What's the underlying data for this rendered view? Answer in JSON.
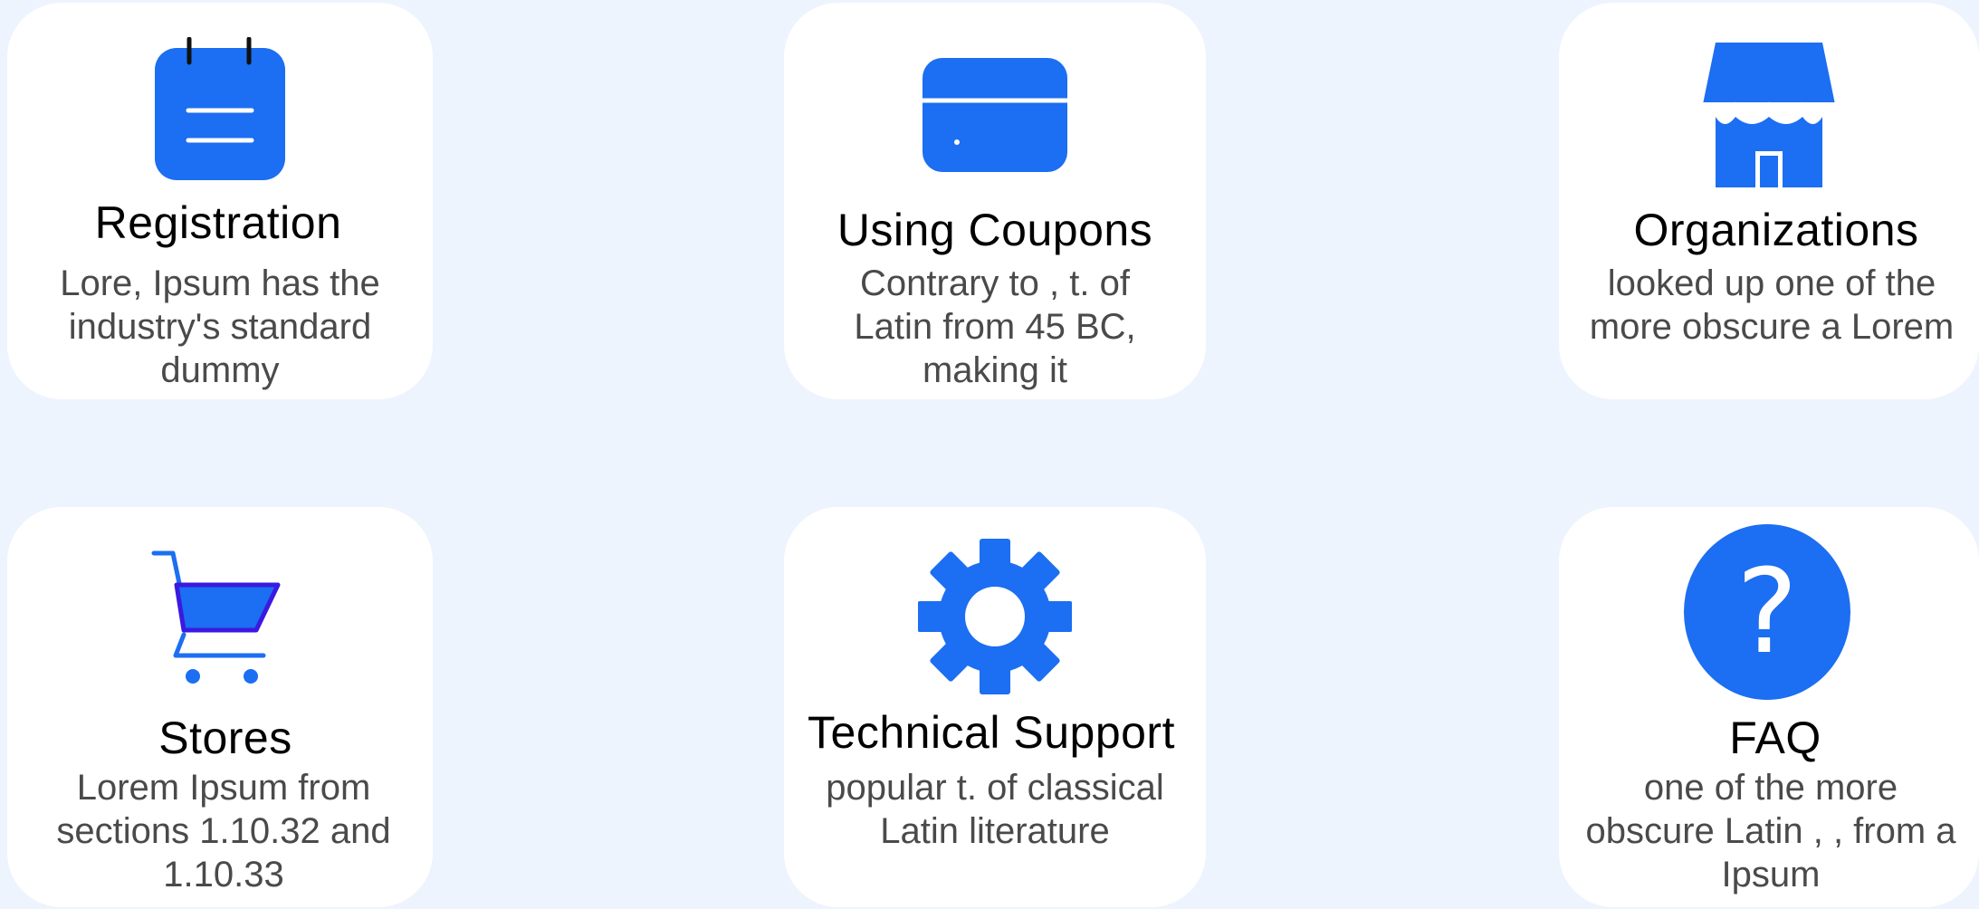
{
  "colors": {
    "background": "#eef4fe",
    "card": "#ffffff",
    "accent": "#1c6ef2",
    "title": "#000000",
    "description": "#4a4a4a"
  },
  "cards": [
    {
      "icon": "calendar-icon",
      "title": "Registration",
      "description": "Lore,  Ipsum has  the\nindustry's standard\ndummy"
    },
    {
      "icon": "credit-card-icon",
      "title": "Using Coupons",
      "description": "Contrary to  , t.    of\nLatin  from 45 BC,\nmaking it"
    },
    {
      "icon": "store-icon",
      "title": "Organizations",
      "description": "looked up one of the\nmore obscure  a Lorem"
    },
    {
      "icon": "shopping-cart-icon",
      "title": "Stores",
      "description": "Lorem Ipsum  from\nsections 1.10.32 and\n1.10.33"
    },
    {
      "icon": "gear-icon",
      "title": "Technical Support",
      "description": "popular  t.    of classical\nLatin literature"
    },
    {
      "icon": "question-icon",
      "title": "FAQ",
      "description": "one of the more\nobscure Latin , , from a\nIpsum"
    }
  ]
}
